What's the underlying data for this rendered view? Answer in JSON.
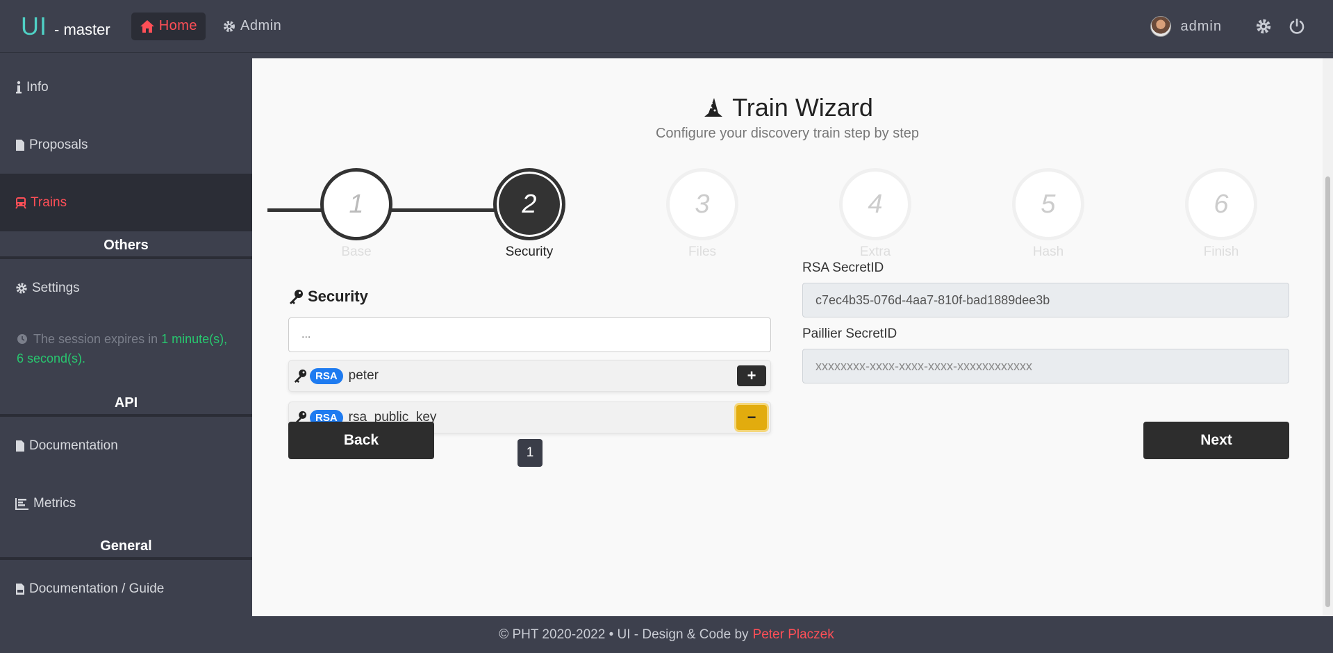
{
  "header": {
    "brand": "UI",
    "brand_suffix": "- master",
    "nav": [
      {
        "label": "Home",
        "icon": "home-icon",
        "active": true
      },
      {
        "label": "Admin",
        "icon": "gear-icon",
        "active": false
      }
    ],
    "user": "admin",
    "accent_color": "#ff4f57"
  },
  "sidebar": {
    "items": [
      {
        "label": "Info",
        "icon": "info-icon"
      },
      {
        "label": "Proposals",
        "icon": "file-icon"
      },
      {
        "label": "Trains",
        "icon": "train-icon",
        "active": true
      }
    ],
    "others_heading": "Others",
    "settings_label": "Settings",
    "session_prefix": "The session expires in",
    "session_time": "1 minute(s), 6 second(s).",
    "api_heading": "API",
    "api_items": [
      {
        "label": "Documentation",
        "icon": "file-icon"
      },
      {
        "label": "Metrics",
        "icon": "chart-icon"
      }
    ],
    "general_heading": "General",
    "general_items": [
      {
        "label": "Documentation / Guide",
        "icon": "pdf-icon"
      }
    ]
  },
  "wizard": {
    "title": "Train Wizard",
    "subtitle": "Configure your discovery train step by step",
    "steps": [
      {
        "number": "1",
        "label": "Base",
        "state": "done"
      },
      {
        "number": "2",
        "label": "Security",
        "state": "current"
      },
      {
        "number": "3",
        "label": "Files",
        "state": "todo"
      },
      {
        "number": "4",
        "label": "Extra",
        "state": "todo"
      },
      {
        "number": "5",
        "label": "Hash",
        "state": "todo"
      },
      {
        "number": "6",
        "label": "Finish",
        "state": "todo"
      }
    ]
  },
  "security": {
    "title": "Security",
    "search_placeholder": "...",
    "keys": [
      {
        "badge": "RSA",
        "name": "peter",
        "action": "+"
      },
      {
        "badge": "RSA",
        "name": "rsa_public_key",
        "action": "−"
      }
    ],
    "page": "1",
    "rsa_label": "RSA SecretID",
    "rsa_value": "c7ec4b35-076d-4aa7-810f-bad1889dee3b",
    "paillier_label": "Paillier SecretID",
    "paillier_placeholder": "xxxxxxxx-xxxx-xxxx-xxxx-xxxxxxxxxxxx"
  },
  "actions": {
    "back": "Back",
    "next": "Next"
  },
  "footer": {
    "text": "© PHT 2020-2022 • UI - Design & Code by",
    "author": "Peter Placzek"
  }
}
